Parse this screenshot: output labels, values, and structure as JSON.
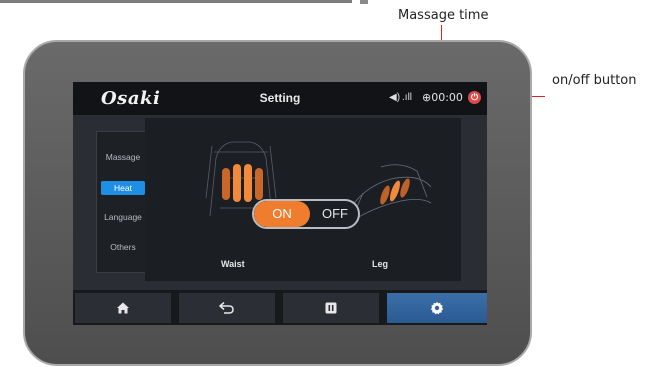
{
  "annotations": {
    "massage_time_label": "Massage time",
    "on_off_label": "on/off button"
  },
  "header": {
    "logo": "Osaki",
    "title": "Setting",
    "volume": "◀) .ıll",
    "timer": "⊕00:00"
  },
  "sidebar": {
    "items": [
      {
        "label": "Massage",
        "active": false
      },
      {
        "label": "Heat",
        "active": true
      },
      {
        "label": "Language",
        "active": false
      },
      {
        "label": "Others",
        "active": false
      }
    ]
  },
  "heat_panel": {
    "left_caption": "Waist",
    "right_caption": "Leg",
    "toggle_on": "ON",
    "toggle_off": "OFF",
    "state": "on"
  },
  "bottom_nav": [
    {
      "icon": "home-icon",
      "active": false
    },
    {
      "icon": "back-icon",
      "active": false
    },
    {
      "icon": "pause-icon",
      "active": false
    },
    {
      "icon": "gear-icon",
      "active": true
    }
  ],
  "colors": {
    "accent": "#1f8fe6",
    "toggle_on": "#f07c2d",
    "annotation": "#e0202a",
    "heat_glow": "#e8732a"
  }
}
